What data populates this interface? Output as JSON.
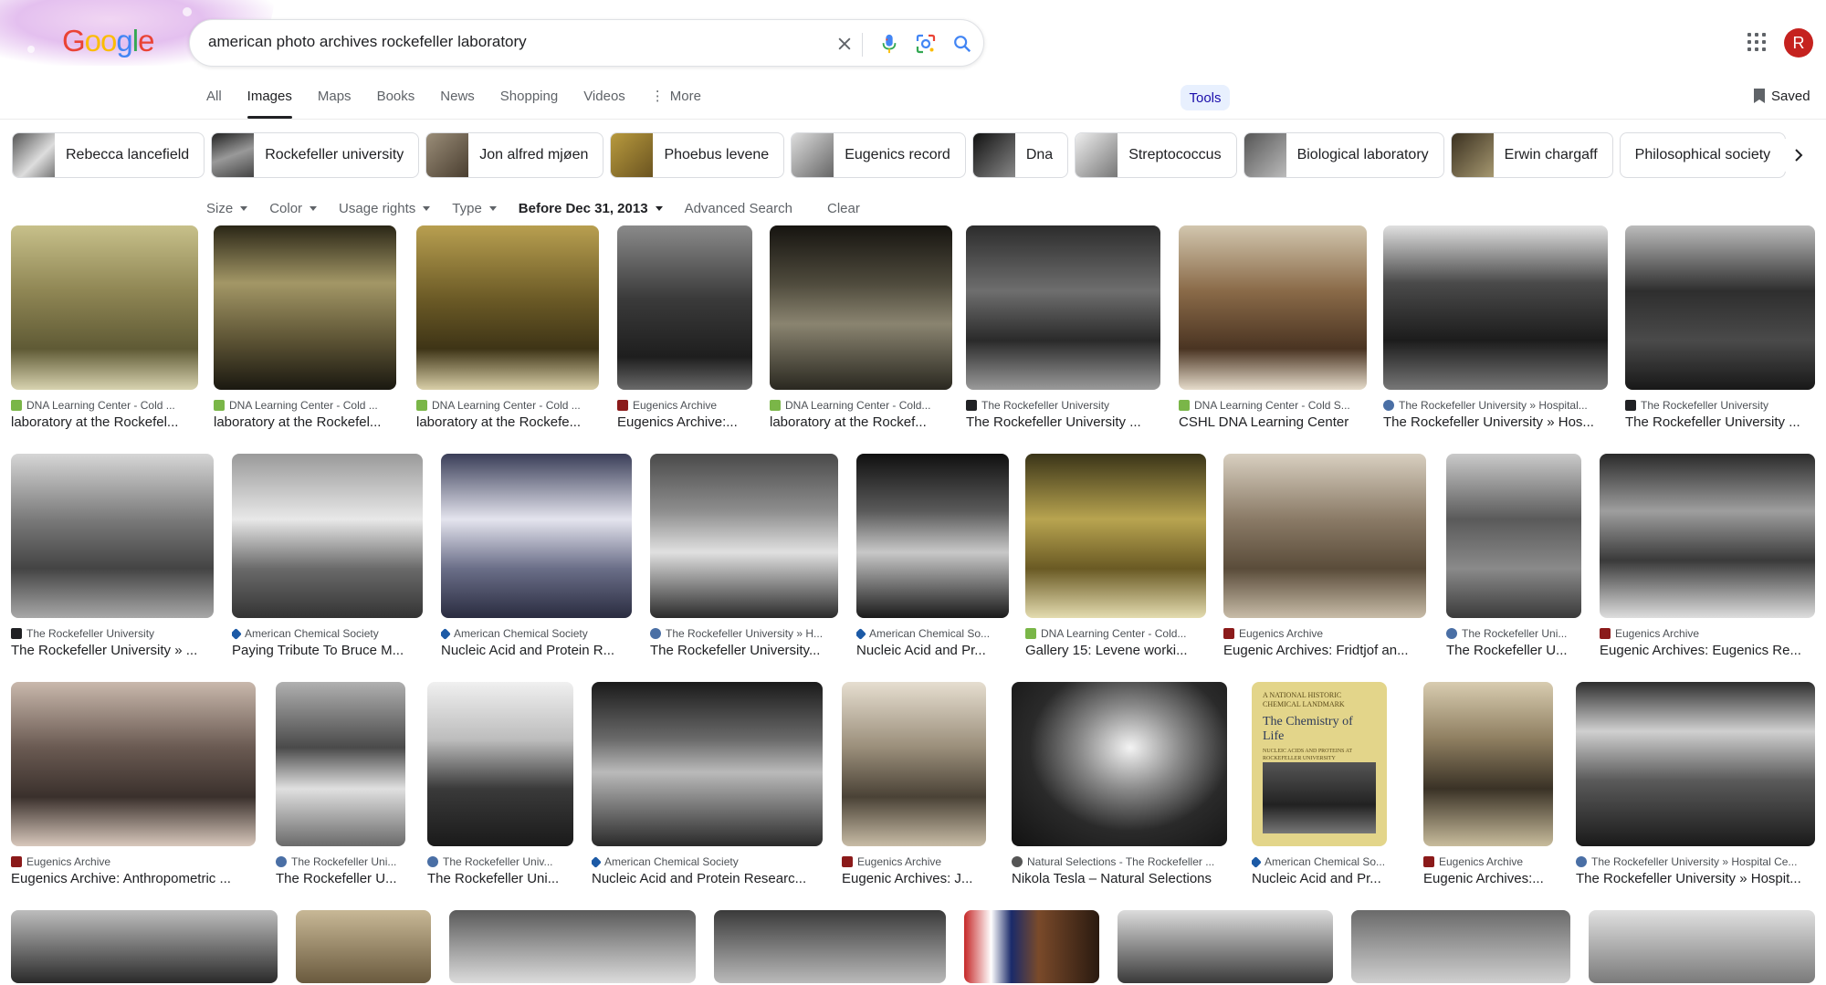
{
  "logo": {
    "text": "Google"
  },
  "search": {
    "query": "american photo archives rockefeller laboratory"
  },
  "nav": {
    "tabs": [
      {
        "label": "All"
      },
      {
        "label": "Images"
      },
      {
        "label": "Maps"
      },
      {
        "label": "Books"
      },
      {
        "label": "News"
      },
      {
        "label": "Shopping"
      },
      {
        "label": "Videos"
      },
      {
        "label": "More"
      }
    ],
    "active": "Images",
    "tools": "Tools",
    "saved": "Saved"
  },
  "user": {
    "initial": "R",
    "color": "#c5221f"
  },
  "chips": [
    {
      "label": "Rebecca lancefield"
    },
    {
      "label": "Rockefeller university"
    },
    {
      "label": "Jon alfred mjøen"
    },
    {
      "label": "Phoebus levene"
    },
    {
      "label": "Eugenics record"
    },
    {
      "label": "Dna"
    },
    {
      "label": "Streptococcus"
    },
    {
      "label": "Biological laboratory"
    },
    {
      "label": "Erwin chargaff"
    },
    {
      "label": "Philosophical society"
    }
  ],
  "filters": [
    {
      "label": "Size"
    },
    {
      "label": "Color"
    },
    {
      "label": "Usage rights"
    },
    {
      "label": "Type"
    },
    {
      "label": "Before Dec 31, 2013"
    },
    {
      "label": "Advanced Search"
    },
    {
      "label": "Clear"
    }
  ],
  "results": {
    "row1": [
      {
        "source": "DNA Learning Center - Cold ...",
        "title": "laboratory at the Rockefel..."
      },
      {
        "source": "DNA Learning Center - Cold ...",
        "title": "laboratory at the Rockefel..."
      },
      {
        "source": "DNA Learning Center - Cold ...",
        "title": "laboratory at the Rockefe..."
      },
      {
        "source": "Eugenics Archive",
        "title": "Eugenics Archive:..."
      },
      {
        "source": "DNA Learning Center - Cold...",
        "title": "laboratory at the Rockef..."
      },
      {
        "source": "The Rockefeller University",
        "title": "The Rockefeller University ..."
      },
      {
        "source": "DNA Learning Center - Cold S...",
        "title": "CSHL DNA Learning Center"
      },
      {
        "source": "The Rockefeller University » Hospital...",
        "title": "The Rockefeller University » Hos..."
      },
      {
        "source": "The Rockefeller University",
        "title": "The Rockefeller University ..."
      }
    ],
    "row2": [
      {
        "source": "The Rockefeller University",
        "title": "The Rockefeller University » ..."
      },
      {
        "source": "American Chemical Society",
        "title": "Paying Tribute To Bruce M..."
      },
      {
        "source": "American Chemical Society",
        "title": "Nucleic Acid and Protein R..."
      },
      {
        "source": "The Rockefeller University » H...",
        "title": "The Rockefeller University..."
      },
      {
        "source": "American Chemical So...",
        "title": "Nucleic Acid and Pr..."
      },
      {
        "source": "DNA Learning Center - Cold...",
        "title": "Gallery 15: Levene worki..."
      },
      {
        "source": "Eugenics Archive",
        "title": "Eugenic Archives: Fridtjof an..."
      },
      {
        "source": "The Rockefeller Uni...",
        "title": "The Rockefeller U..."
      },
      {
        "source": "Eugenics Archive",
        "title": "Eugenic Archives: Eugenics Re..."
      }
    ],
    "row3": [
      {
        "source": "Eugenics Archive",
        "title": "Eugenics Archive: Anthropometric ..."
      },
      {
        "source": "The Rockefeller Uni...",
        "title": "The Rockefeller U..."
      },
      {
        "source": "The Rockefeller Univ...",
        "title": "The Rockefeller Uni..."
      },
      {
        "source": "American Chemical Society",
        "title": "Nucleic Acid and Protein Researc..."
      },
      {
        "source": "Eugenics Archive",
        "title": "Eugenic Archives: J..."
      },
      {
        "source": "Natural Selections - The Rockefeller ...",
        "title": "Nikola Tesla – Natural Selections"
      },
      {
        "source": "American Chemical So...",
        "title": "Nucleic Acid and Pr..."
      },
      {
        "source": "Eugenics Archive",
        "title": "Eugenic Archives:..."
      },
      {
        "source": "The Rockefeller University » Hospital Ce...",
        "title": "The Rockefeller University » Hospit..."
      }
    ],
    "row3_cover_text": {
      "line1": "A NATIONAL HISTORIC CHEMICAL LANDMARK",
      "line2": "The Chemistry of Life",
      "line3": "NUCLEIC ACIDS AND PROTEINS AT ROCKEFELLER UNIVERSITY"
    }
  },
  "colors": {
    "dna_favicon": "#7ab648",
    "eugenics_favicon": "#8b1a1a",
    "rockefeller_favicon": "#202124",
    "acs_favicon": "#1c5aa6",
    "hospital_favicon": "#4a6fa5",
    "natsel_favicon": "#555555"
  }
}
